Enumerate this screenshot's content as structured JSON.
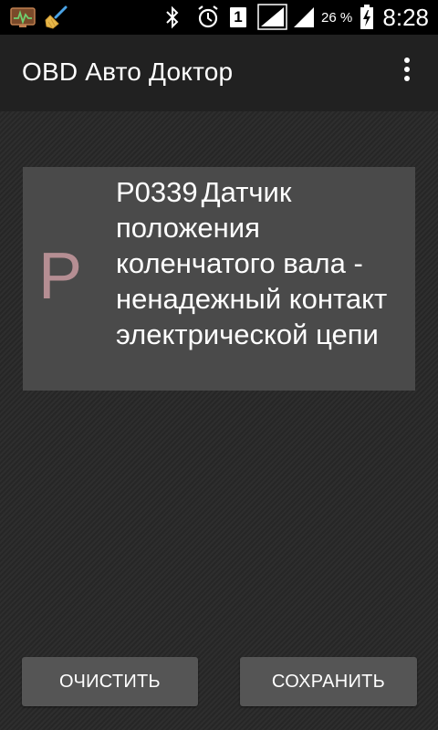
{
  "status_bar": {
    "icons_left": [
      "monitor-chart-icon",
      "broom-icon"
    ],
    "icons_right": [
      "bluetooth-icon",
      "alarm-icon",
      "sim-1-icon",
      "signal-icon",
      "signal-2-icon",
      "battery-charging-icon"
    ],
    "sim_label": "1",
    "battery_percent": "26 %",
    "time": "8:28"
  },
  "action_bar": {
    "title": "OBD Авто Доктор",
    "overflow_icon": "more-vert-icon"
  },
  "code_card": {
    "letter": "P",
    "code": "P0339",
    "description": "Датчик положения коленчатого вала - ненадежный контакт электрической цепи"
  },
  "buttons": {
    "clear_label": "ОЧИСТИТЬ",
    "save_label": "СОХРАНИТЬ"
  },
  "colors": {
    "status_bar_bg": "#000000",
    "action_bar_bg": "#212121",
    "card_bg": "#4a4a4a",
    "letter_color": "#b58e93",
    "button_bg": "#555555"
  }
}
